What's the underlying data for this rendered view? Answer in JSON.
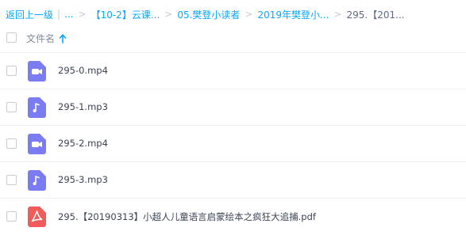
{
  "breadcrumb": {
    "back_label": "返回上一级",
    "ellipsis": "...",
    "items": [
      "【10-2】云课...",
      "05.樊登小读者",
      "2019年樊登小...",
      "295.【201..."
    ]
  },
  "header": {
    "filename_label": "文件名",
    "sort_icon": "arrow-up-icon",
    "accent_color": "#06a7ff"
  },
  "files": [
    {
      "name": "295-0.mp4",
      "icon": "video-icon",
      "color": "#7b7cf3"
    },
    {
      "name": "295-1.mp3",
      "icon": "audio-icon",
      "color": "#7b7cf3"
    },
    {
      "name": "295-2.mp4",
      "icon": "video-icon",
      "color": "#7b7cf3"
    },
    {
      "name": "295-3.mp3",
      "icon": "audio-icon",
      "color": "#7b7cf3"
    },
    {
      "name": "295.【20190313】小超人儿童语言启蒙绘本之疯狂大追捕.pdf",
      "icon": "pdf-icon",
      "color": "#f25b5b"
    }
  ]
}
